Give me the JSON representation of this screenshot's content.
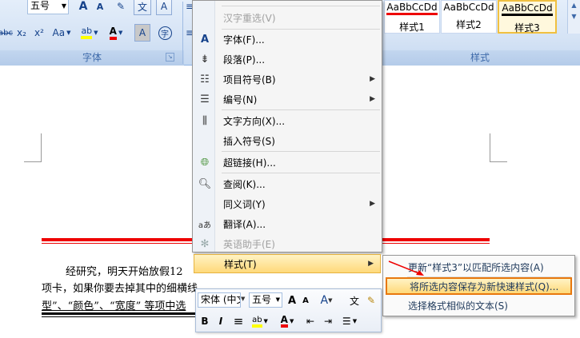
{
  "ribbon": {
    "font_size_value": "五号",
    "font_group_label": "字体",
    "style_group_label": "样式",
    "buttons": {
      "grow_font": "A",
      "shrink_font": "A",
      "clear_format": "✎",
      "phonetic": "文",
      "char_border": "A",
      "strike": "abc",
      "subscript": "x₂",
      "superscript": "x²",
      "change_case": "Aa",
      "highlight": "ab",
      "font_color": "A",
      "char_shading": "A",
      "enclose": "字"
    },
    "styles": [
      {
        "sample": "AaBbCcDd",
        "name": "样式1"
      },
      {
        "sample": "AaBbCcDd",
        "name": "样式2"
      },
      {
        "sample": "AaBbCcDd",
        "name": "样式3"
      }
    ]
  },
  "document": {
    "lines": [
      "经研究，明天开始放假12",
      "项卡，如果你要去掉其中的细横线",
      "型”、“颜色”、“宽度” 等项中选"
    ]
  },
  "context_menu": {
    "items": [
      {
        "label": "汉字重选(V)",
        "icon": "none",
        "disabled": true
      },
      {
        "label": "字体(F)...",
        "icon": "font-icon"
      },
      {
        "label": "段落(P)...",
        "icon": "paragraph-icon"
      },
      {
        "label": "项目符号(B)",
        "icon": "bullets-icon",
        "submenu": true
      },
      {
        "label": "编号(N)",
        "icon": "numbering-icon",
        "submenu": true
      },
      {
        "label": "文字方向(X)...",
        "icon": "text-direction-icon"
      },
      {
        "label": "插入符号(S)",
        "icon": "none"
      },
      {
        "label": "超链接(H)...",
        "icon": "hyperlink-icon"
      },
      {
        "label": "查阅(K)...",
        "icon": "lookup-icon"
      },
      {
        "label": "同义词(Y)",
        "icon": "none",
        "submenu": true
      },
      {
        "label": "翻译(A)...",
        "icon": "translate-icon"
      },
      {
        "label": "英语助手(E)",
        "icon": "english-assistant-icon",
        "disabled": true
      },
      {
        "label": "样式(T)",
        "icon": "none",
        "submenu": true,
        "highlighted": true
      }
    ]
  },
  "submenu": {
    "items": [
      {
        "label": "更新“样式3”以匹配所选内容(A)"
      },
      {
        "label": "将所选内容保存为新快速样式(Q)...",
        "highlighted": true
      },
      {
        "label": "选择格式相似的文本(S)"
      }
    ]
  },
  "mini_toolbar": {
    "font_name": "宋体 (中文",
    "font_size": "五号",
    "grow": "A",
    "shrink": "A",
    "styles_btn": "A",
    "phonetic": "文",
    "format_painter": "✎",
    "bold": "B",
    "italic": "I",
    "center": "≡",
    "highlight": "ab",
    "font_color": "A",
    "indent_dec": "⇤",
    "indent_inc": "⇥",
    "bullets": "☰"
  },
  "colors": {
    "ribbon_bg": "#d5e3f5",
    "highlight": "#ffd97a",
    "accent_red": "#e00000"
  }
}
